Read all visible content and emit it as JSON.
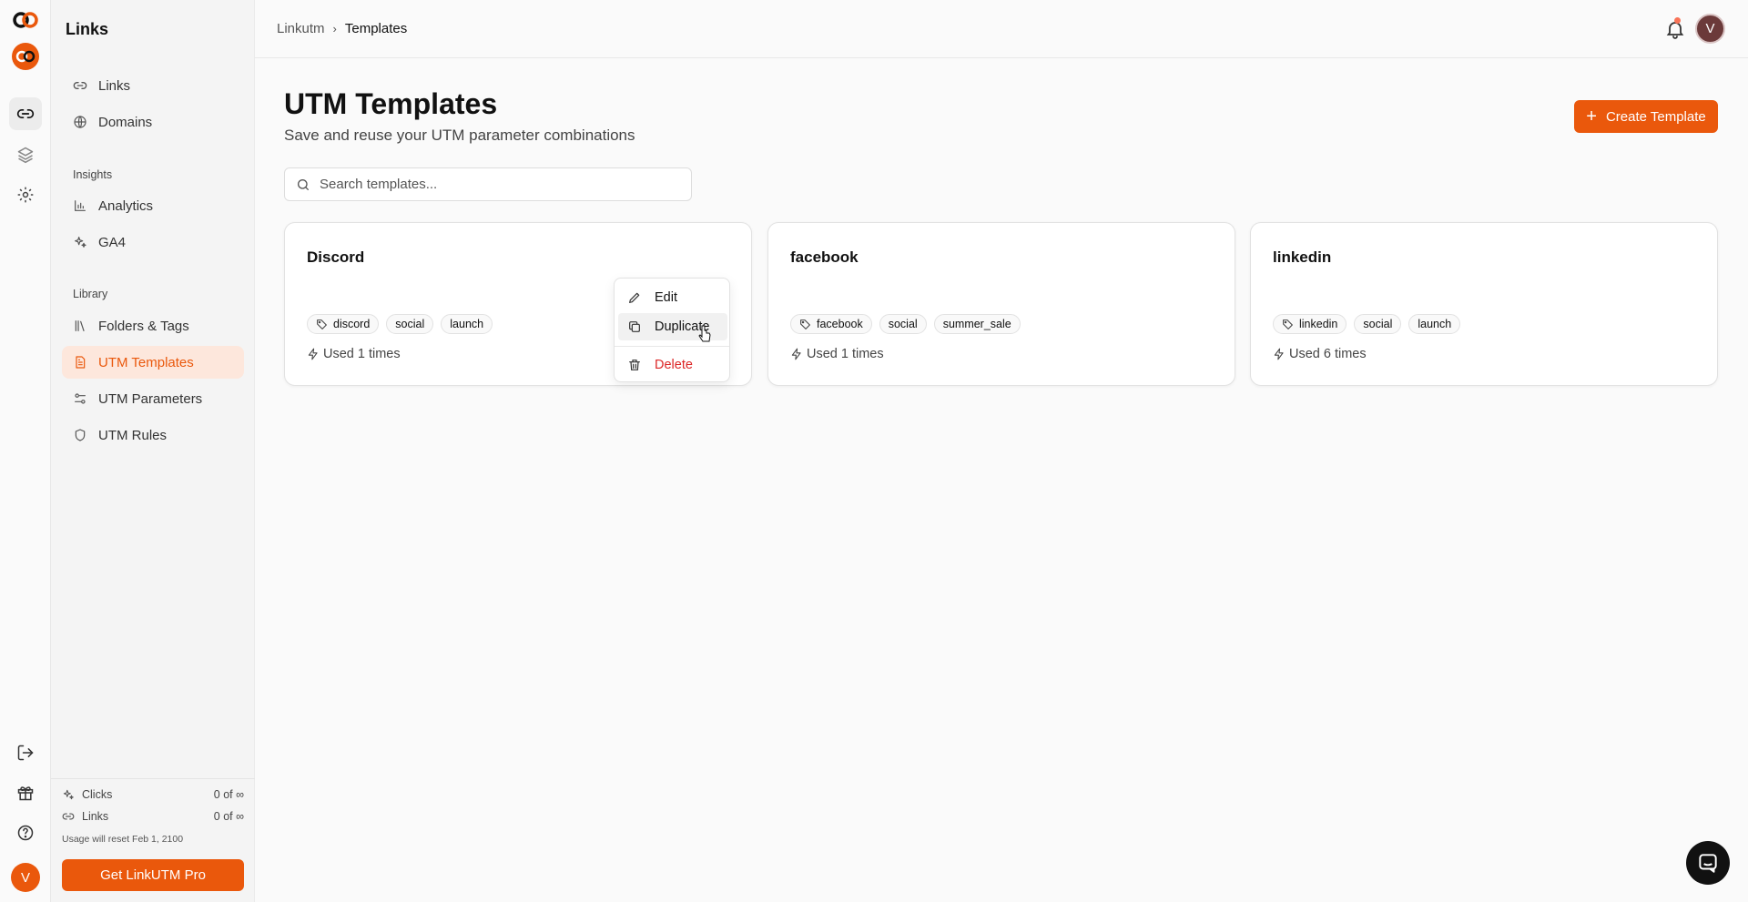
{
  "sidebar": {
    "title": "Links",
    "items": [
      {
        "label": "Links"
      },
      {
        "label": "Domains"
      }
    ],
    "insights_label": "Insights",
    "insights_items": [
      {
        "label": "Analytics"
      },
      {
        "label": "GA4"
      }
    ],
    "library_label": "Library",
    "library_items": [
      {
        "label": "Folders & Tags"
      },
      {
        "label": "UTM Templates"
      },
      {
        "label": "UTM Parameters"
      },
      {
        "label": "UTM Rules"
      }
    ],
    "usage": {
      "clicks_label": "Clicks",
      "clicks_value": "0 of ∞",
      "links_label": "Links",
      "links_value": "0 of ∞",
      "reset_note": "Usage will reset Feb 1, 2100"
    },
    "pro_button": "Get LinkUTM Pro"
  },
  "rail": {
    "avatar_initial": "V"
  },
  "header": {
    "breadcrumb": [
      "Linkutm",
      "Templates"
    ],
    "avatar_initial": "V"
  },
  "main": {
    "title": "UTM Templates",
    "subtitle": "Save and reuse your UTM parameter combinations",
    "create_button": "Create Template",
    "search_placeholder": "Search templates..."
  },
  "cards": [
    {
      "title": "Discord",
      "tags": [
        "discord",
        "social",
        "launch"
      ],
      "used": "Used 1 times"
    },
    {
      "title": "facebook",
      "tags": [
        "facebook",
        "social",
        "summer_sale"
      ],
      "used": "Used 1 times"
    },
    {
      "title": "linkedin",
      "tags": [
        "linkedin",
        "social",
        "launch"
      ],
      "used": "Used 6 times"
    }
  ],
  "menu": {
    "edit": "Edit",
    "duplicate": "Duplicate",
    "delete": "Delete"
  },
  "colors": {
    "accent": "#ea580c",
    "danger": "#dc2626",
    "active_bg": "#fde7dc"
  },
  "icons": [
    "logo-icon",
    "link-icon",
    "layers-icon",
    "gear-icon",
    "logout-icon",
    "gift-icon",
    "help-icon",
    "globe-icon",
    "bar-chart-icon",
    "sparkle-icon",
    "library-icon",
    "file-icon",
    "sliders-icon",
    "shield-icon",
    "bell-icon",
    "search-icon",
    "tag-icon",
    "bolt-icon",
    "pencil-icon",
    "copy-icon",
    "trash-icon",
    "chat-icon"
  ]
}
